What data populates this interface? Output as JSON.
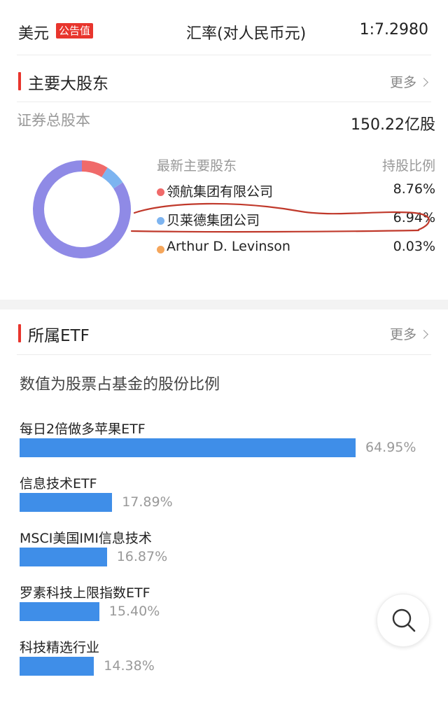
{
  "header": {
    "currency": "美元",
    "badge": "公告值",
    "rate_label": "汇率(对人民币元)",
    "rate_value": "1:7.2980"
  },
  "shareholders": {
    "title": "主要大股东",
    "more_label": "更多",
    "total_label": "证券总股本",
    "total_value": "150.22亿股",
    "column_name": "最新主要股东",
    "column_ratio": "持股比例",
    "items": [
      {
        "name": "领航集团有限公司",
        "percent": "8.76%",
        "value": 8.76,
        "color": "#f06a6a"
      },
      {
        "name": "贝莱德集团公司",
        "percent": "6.94%",
        "value": 6.94,
        "color": "#7db4f0"
      },
      {
        "name": "Arthur D. Levinson",
        "percent": "0.03%",
        "value": 0.03,
        "color": "#f5a65b"
      }
    ],
    "others_color": "#8f8ae6",
    "annotation_color": "#c0392b"
  },
  "etf": {
    "title": "所属ETF",
    "more_label": "更多",
    "note": "数值为股票占基金的股份比例",
    "bar_color": "#3f8ee8",
    "items": [
      {
        "name": "每日2倍做多苹果ETF",
        "percent": "64.95%",
        "value": 64.95
      },
      {
        "name": "信息技术ETF",
        "percent": "17.89%",
        "value": 17.89
      },
      {
        "name": "MSCI美国IMI信息技术",
        "percent": "16.87%",
        "value": 16.87
      },
      {
        "name": "罗素科技上限指数ETF",
        "percent": "15.40%",
        "value": 15.4
      },
      {
        "name": "科技精选行业",
        "percent": "14.38%",
        "value": 14.38
      }
    ]
  },
  "icons": {
    "search": "search-icon",
    "more": "chevron-right-icon"
  }
}
